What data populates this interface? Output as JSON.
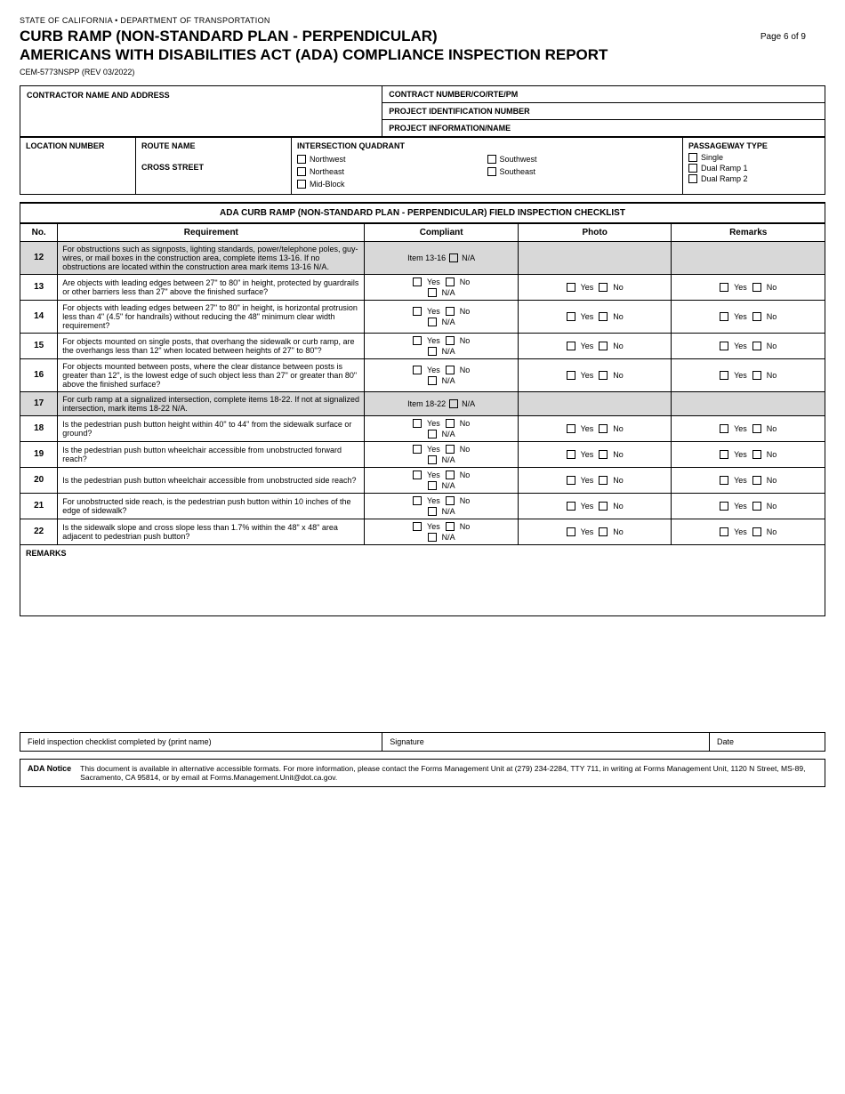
{
  "header": {
    "state_line": "STATE OF CALIFORNIA • DEPARTMENT OF TRANSPORTATION",
    "title_line1": "CURB RAMP (NON-STANDARD PLAN - PERPENDICULAR)",
    "title_line2": "AMERICANS WITH DISABILITIES ACT (ADA) COMPLIANCE INSPECTION REPORT",
    "form_number": "CEM-5773NSPP (REV 03/2022)",
    "page": "Page 6 of 9"
  },
  "contractor": {
    "label": "CONTRACTOR NAME AND ADDRESS"
  },
  "contract": {
    "number_label": "CONTRACT NUMBER/CO/RTE/PM",
    "project_id_label": "PROJECT IDENTIFICATION NUMBER",
    "project_info_label": "PROJECT INFORMATION/NAME"
  },
  "location": {
    "location_number_label": "Location Number",
    "route_name_label": "Route Name",
    "cross_street_label": "Cross Street",
    "intersection_quadrant_label": "Intersection Quadrant",
    "quadrants": [
      "Northwest",
      "Southwest",
      "Northeast",
      "Southeast",
      "Mid-Block"
    ],
    "passageway_label": "Passageway Type",
    "passageways": [
      "Single",
      "Dual Ramp 1",
      "Dual Ramp 2"
    ]
  },
  "checklist": {
    "title": "ADA CURB RAMP (NON-STANDARD PLAN - PERPENDICULAR) FIELD INSPECTION CHECKLIST",
    "headers": {
      "no": "No.",
      "requirement": "Requirement",
      "compliant": "Compliant",
      "photo": "Photo",
      "remarks": "Remarks"
    },
    "rows": [
      {
        "no": "12",
        "requirement": "For obstructions such as signposts, lighting standards, power/telephone poles, guy-wires, or mail boxes in the construction area, complete items 13-16. If no obstructions are located within the construction area mark items 13-16 N/A.",
        "shaded": true,
        "compliant_type": "item_range",
        "compliant_text": "Item 13-16",
        "photo_shaded": true,
        "remarks_shaded": true
      },
      {
        "no": "13",
        "requirement": "Are objects with leading edges between 27\" to 80\" in height, protected by guardrails or other barriers less than 27\" above the finished surface?",
        "shaded": false,
        "compliant_type": "yes_no_na",
        "photo_type": "yes_no",
        "remarks_type": "yes_no"
      },
      {
        "no": "14",
        "requirement": "For objects with leading edges between 27\" to 80\" in height, is horizontal protrusion less than 4\" (4.5\" for handrails) without reducing the 48\" minimum clear width requirement?",
        "shaded": false,
        "compliant_type": "yes_no_na",
        "photo_type": "yes_no",
        "remarks_type": "yes_no"
      },
      {
        "no": "15",
        "requirement": "For objects mounted on single posts, that overhang the sidewalk or curb ramp, are the overhangs less than 12\" when located between heights of 27\" to 80\"?",
        "shaded": false,
        "compliant_type": "yes_no_na",
        "photo_type": "yes_no",
        "remarks_type": "yes_no"
      },
      {
        "no": "16",
        "requirement": "For objects mounted between posts, where the clear distance between posts is greater than 12\", is the lowest edge of such object less than 27\" or greater than 80\" above the finished surface?",
        "shaded": false,
        "compliant_type": "yes_no_na",
        "photo_type": "yes_no",
        "remarks_type": "yes_no"
      },
      {
        "no": "17",
        "requirement": "For curb ramp at a signalized intersection, complete items 18-22. If not at signalized intersection, mark items 18-22 N/A.",
        "shaded": true,
        "compliant_type": "item_range",
        "compliant_text": "Item 18-22",
        "photo_shaded": true,
        "remarks_shaded": true
      },
      {
        "no": "18",
        "requirement": "Is the pedestrian push button height within 40\" to 44\" from the sidewalk surface or ground?",
        "shaded": false,
        "compliant_type": "yes_no_na",
        "photo_type": "yes_no",
        "remarks_type": "yes_no"
      },
      {
        "no": "19",
        "requirement": "Is the pedestrian push button wheelchair accessible from unobstructed forward reach?",
        "shaded": false,
        "compliant_type": "yes_no_na",
        "photo_type": "yes_no",
        "remarks_type": "yes_no"
      },
      {
        "no": "20",
        "requirement": "Is the pedestrian push button wheelchair accessible from unobstructed side reach?",
        "shaded": false,
        "compliant_type": "yes_no_na",
        "photo_type": "yes_no",
        "remarks_type": "yes_no"
      },
      {
        "no": "21",
        "requirement": "For unobstructed side reach, is the pedestrian push button within 10 inches of the edge of sidewalk?",
        "shaded": false,
        "compliant_type": "yes_no_na",
        "photo_type": "yes_no",
        "remarks_type": "yes_no"
      },
      {
        "no": "22",
        "requirement": "Is the sidewalk slope and cross slope less than 1.7% within the 48\" x 48\" area adjacent to pedestrian push button?",
        "shaded": false,
        "compliant_type": "yes_no_na",
        "photo_type": "yes_no",
        "remarks_type": "yes_no"
      }
    ]
  },
  "remarks_footer": "Remarks",
  "signature": {
    "print_name_label": "Field inspection checklist completed by (print name)",
    "signature_label": "Signature",
    "date_label": "Date"
  },
  "ada_notice": {
    "label": "ADA Notice",
    "text": "This document is available in alternative accessible formats. For more information, please contact the Forms Management Unit at (279) 234-2284, TTY 711, in writing at Forms Management Unit, 1120 N Street, MS-89, Sacramento, CA 95814, or by email at Forms.Management.Unit@dot.ca.gov."
  }
}
